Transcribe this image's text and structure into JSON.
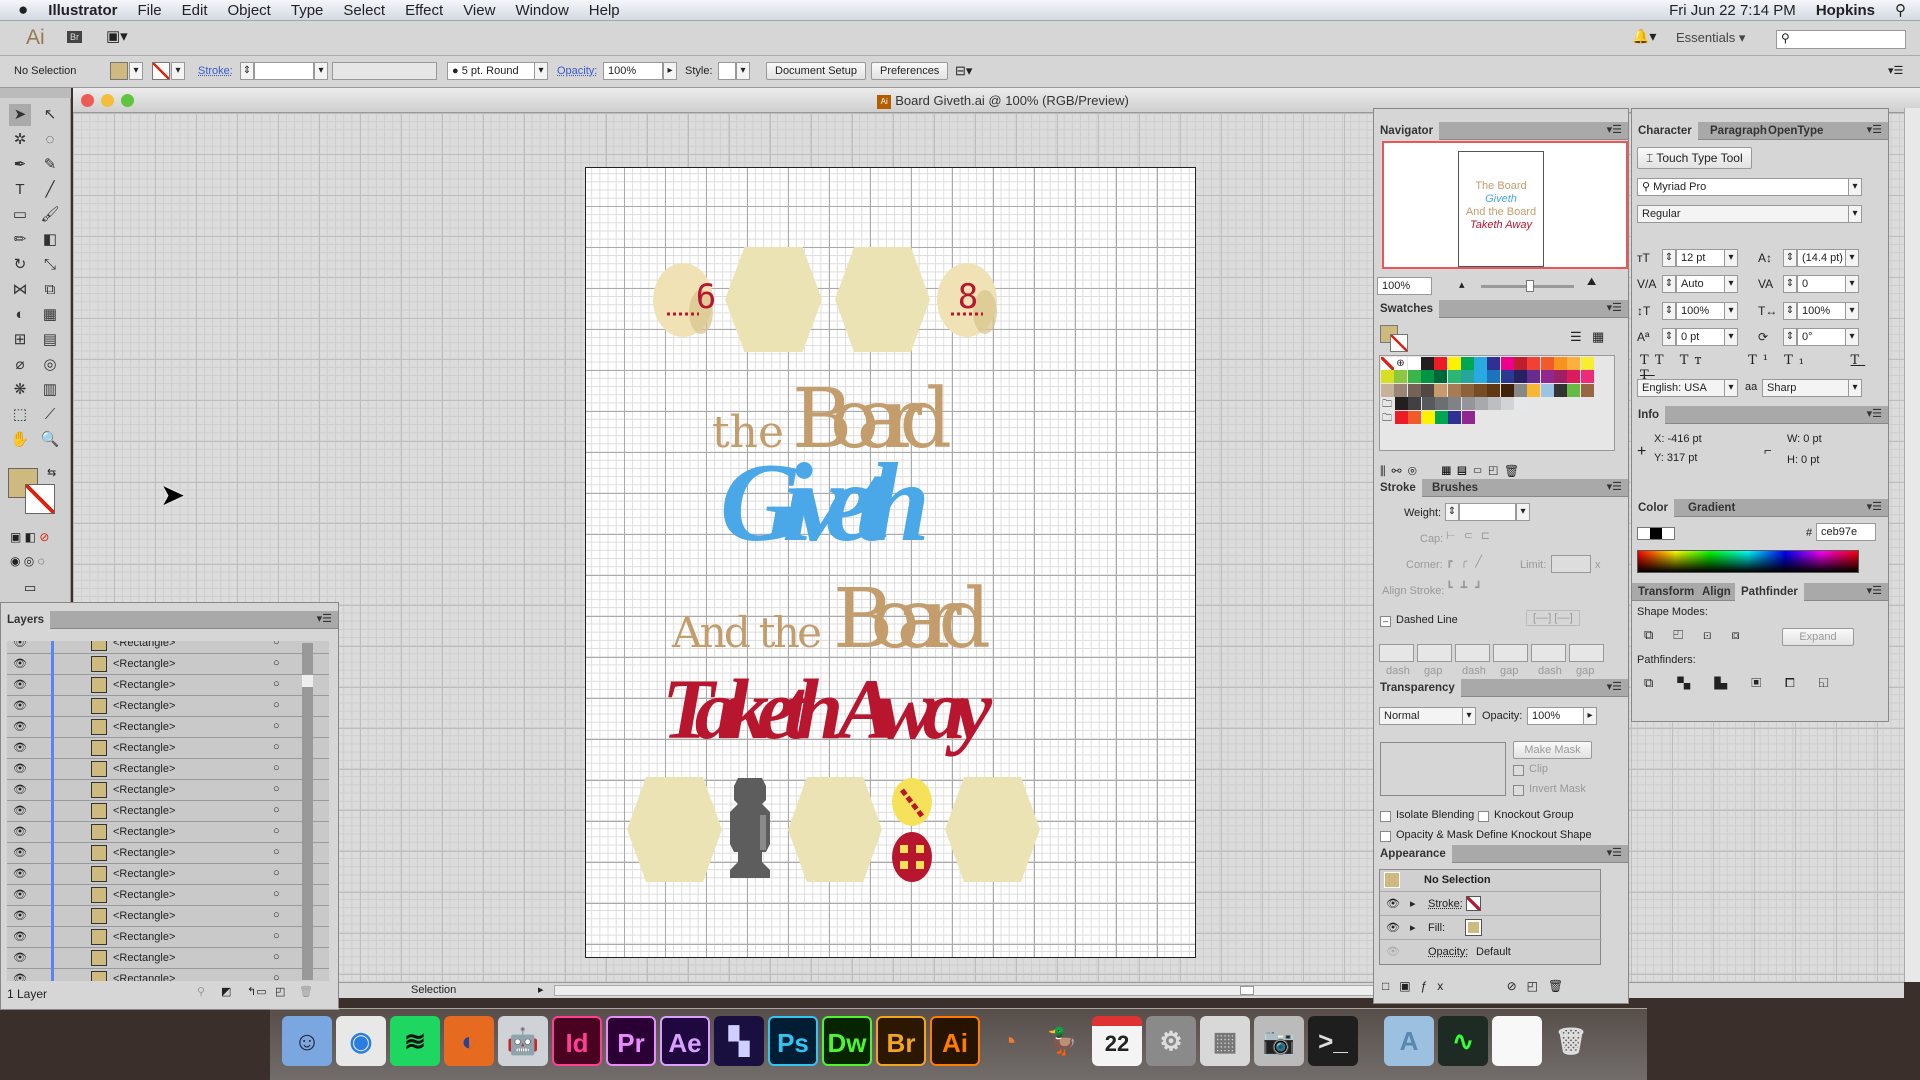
{
  "menubar": {
    "apple": "",
    "items": [
      "Illustrator",
      "File",
      "Edit",
      "Object",
      "Type",
      "Select",
      "Effect",
      "View",
      "Window",
      "Help"
    ],
    "clock": "Fri Jun 22  7:14 PM",
    "user": "Hopkins"
  },
  "appbar": {
    "logo": "Ai",
    "bridge": "Br",
    "workspace": "Essentials",
    "search_placeholder": ""
  },
  "control": {
    "selection": "No Selection",
    "stroke_label": "Stroke:",
    "brush": "5 pt. Round",
    "opacity_label": "Opacity:",
    "opacity": "100%",
    "style_label": "Style:",
    "document_setup": "Document Setup",
    "preferences": "Preferences",
    "fill_color": "#ceb97e"
  },
  "document": {
    "title": "Board Giveth.ai @ 100% (RGB/Preview)",
    "zoom_status": "Selection"
  },
  "artwork": {
    "line1_small": "the",
    "line1_big": "Board",
    "line2": "Giveth",
    "line3_small": "And the",
    "line3_big": "Board",
    "line4": "Taketh Away",
    "die1": "6",
    "die2": "8",
    "colors": {
      "hex": "#ece3b4",
      "tan": "#c49d6d",
      "blue": "#4aa8e8",
      "red": "#b8162e",
      "die": "#f0e2b5",
      "pawn": "#5d5d5d",
      "yellow": "#f5e25a"
    }
  },
  "tools": [
    {
      "name": "selection-tool",
      "glyph": "➤"
    },
    {
      "name": "direct-selection-tool",
      "glyph": "↖"
    },
    {
      "name": "magic-wand-tool",
      "glyph": "✲"
    },
    {
      "name": "lasso-tool",
      "glyph": "◌"
    },
    {
      "name": "pen-tool",
      "glyph": "✒"
    },
    {
      "name": "curvature-tool",
      "glyph": "✎"
    },
    {
      "name": "type-tool",
      "glyph": "T"
    },
    {
      "name": "line-tool",
      "glyph": "╱"
    },
    {
      "name": "rectangle-tool",
      "glyph": "▭"
    },
    {
      "name": "paintbrush-tool",
      "glyph": "🖌"
    },
    {
      "name": "pencil-tool",
      "glyph": "✏"
    },
    {
      "name": "eraser-tool",
      "glyph": "◧"
    },
    {
      "name": "rotate-tool",
      "glyph": "↻"
    },
    {
      "name": "scale-tool",
      "glyph": "⤡"
    },
    {
      "name": "width-tool",
      "glyph": "⋈"
    },
    {
      "name": "free-transform-tool",
      "glyph": "⧉"
    },
    {
      "name": "shape-builder-tool",
      "glyph": "◐"
    },
    {
      "name": "perspective-grid-tool",
      "glyph": "▦"
    },
    {
      "name": "mesh-tool",
      "glyph": "⊞"
    },
    {
      "name": "gradient-tool",
      "glyph": "▤"
    },
    {
      "name": "eyedropper-tool",
      "glyph": "⌀"
    },
    {
      "name": "blend-tool",
      "glyph": "◎"
    },
    {
      "name": "symbol-sprayer-tool",
      "glyph": "❋"
    },
    {
      "name": "column-graph-tool",
      "glyph": "▥"
    },
    {
      "name": "artboard-tool",
      "glyph": "⬚"
    },
    {
      "name": "slice-tool",
      "glyph": "⟋"
    },
    {
      "name": "hand-tool",
      "glyph": "✋"
    },
    {
      "name": "zoom-tool",
      "glyph": "🔍"
    }
  ],
  "layers": {
    "title": "Layers",
    "footer": "1 Layer",
    "rows": [
      "<Rectangle>",
      "<Rectangle>",
      "<Rectangle>",
      "<Rectangle>",
      "<Rectangle>",
      "<Rectangle>",
      "<Rectangle>",
      "<Rectangle>",
      "<Rectangle>",
      "<Rectangle>",
      "<Rectangle>",
      "<Rectangle>",
      "<Rectangle>",
      "<Rectangle>",
      "<Rectangle>",
      "<Rectangle>",
      "<Rectangle>"
    ]
  },
  "navigator": {
    "title": "Navigator",
    "zoom": "100%"
  },
  "swatches": {
    "title": "Swatches",
    "colors": [
      "#ffffff",
      "#231f20",
      "#ed1c24",
      "#fff200",
      "#00a651",
      "#29abe2",
      "#2e3192",
      "#ec008c",
      "#be1e2d",
      "#ef4136",
      "#f15a29",
      "#f7941d",
      "#fbb040",
      "#f9ed32",
      "#d7df23",
      "#8dc63f",
      "#39b54a",
      "#009444",
      "#006838",
      "#2bb673",
      "#26a69a",
      "#27aae1",
      "#1c75bc",
      "#2b3990",
      "#262262",
      "#662d91",
      "#92278f",
      "#9e1f63",
      "#da1c5c",
      "#ee2a7b",
      "#c7b299",
      "#998675",
      "#736357",
      "#534741",
      "#c69c6d",
      "#a67c52",
      "#8c6239",
      "#754c24",
      "#603913",
      "#42210b",
      "#888888",
      "#f7b733",
      "#9cc3e6",
      "#333333",
      "#66bb44",
      "#996644"
    ],
    "grays": [
      "#231f20",
      "#414042",
      "#58595b",
      "#6d6e71",
      "#808285",
      "#939598",
      "#a7a9ac",
      "#bcbec0",
      "#d1d3d4",
      "#e6e7e8"
    ],
    "brights": [
      "#ed1c24",
      "#f15a29",
      "#fff200",
      "#00a651",
      "#2e3192",
      "#92278f"
    ]
  },
  "stroke": {
    "tab": "Stroke",
    "tab2": "Brushes",
    "weight": "Weight:",
    "cap": "Cap:",
    "corner": "Corner:",
    "limit": "Limit:",
    "limit_x": "x",
    "align": "Align Stroke:",
    "dashed": "Dashed Line",
    "dash_labels": [
      "dash",
      "gap",
      "dash",
      "gap",
      "dash",
      "gap"
    ]
  },
  "transparency": {
    "title": "Transparency",
    "mode": "Normal",
    "opacity_label": "Opacity:",
    "opacity": "100%",
    "make_mask": "Make Mask",
    "clip": "Clip",
    "invert": "Invert Mask",
    "isolate": "Isolate Blending",
    "knockout": "Knockout Group",
    "define": "Opacity & Mask Define Knockout Shape"
  },
  "appearance": {
    "title": "Appearance",
    "header": "No Selection",
    "stroke": "Stroke:",
    "fill": "Fill:",
    "opacity": "Opacity:",
    "opacity_value": "Default"
  },
  "character": {
    "tabs": [
      "Character",
      "Paragraph",
      "OpenType"
    ],
    "touch_type": "Touch Type Tool",
    "font": "Myriad Pro",
    "style": "Regular",
    "size": "12 pt",
    "leading": "(14.4 pt)",
    "kerning": "Auto",
    "tracking": "0",
    "vscale": "100%",
    "hscale": "100%",
    "baseline": "0 pt",
    "rotation": "0°",
    "language": "English: USA",
    "aa_label": "aa",
    "antialias": "Sharp"
  },
  "info": {
    "title": "Info",
    "x": "X:  -416 pt",
    "y": "Y:  317 pt",
    "w": "W:  0 pt",
    "h": "H:  0 pt"
  },
  "color": {
    "tabs": [
      "Color",
      "Gradient"
    ],
    "hash": "#",
    "hex": "ceb97e"
  },
  "pathfinder": {
    "tabs": [
      "Transform",
      "Align",
      "Pathfinder"
    ],
    "shape_modes": "Shape Modes:",
    "expand": "Expand",
    "pathfinders": "Pathfinders:"
  },
  "dock": [
    {
      "name": "finder",
      "label": "☺",
      "bg": "#7aa7e0",
      "fg": "#223"
    },
    {
      "name": "chrome",
      "label": "◉",
      "bg": "#e8e8e8",
      "fg": "#2a7de1"
    },
    {
      "name": "spotify",
      "label": "≋",
      "bg": "#1ed760",
      "fg": "#111"
    },
    {
      "name": "firefox",
      "label": "◐",
      "bg": "#e66a1f",
      "fg": "#23449a"
    },
    {
      "name": "automator",
      "label": "🤖",
      "bg": "#cfd3d8",
      "fg": "#333"
    },
    {
      "name": "indesign",
      "label": "Id",
      "bg": "#49021f",
      "fg": "#ff3f94"
    },
    {
      "name": "premiere",
      "label": "Pr",
      "bg": "#2a0034",
      "fg": "#e98bff"
    },
    {
      "name": "after-effects",
      "label": "Ae",
      "bg": "#1f0740",
      "fg": "#d8a1ff"
    },
    {
      "name": "media-encoder",
      "label": "▚",
      "bg": "#1a1040",
      "fg": "#cfd0ff"
    },
    {
      "name": "photoshop",
      "label": "Ps",
      "bg": "#001d34",
      "fg": "#31c5f0"
    },
    {
      "name": "dreamweaver",
      "label": "Dw",
      "bg": "#072401",
      "fg": "#4cf52d"
    },
    {
      "name": "bridge",
      "label": "Br",
      "bg": "#2c1800",
      "fg": "#f2a51e"
    },
    {
      "name": "illustrator",
      "label": "Ai",
      "bg": "#261300",
      "fg": "#ff7c00"
    },
    {
      "name": "blender",
      "label": "◔",
      "bg": "transparent",
      "fg": "#f5792a"
    },
    {
      "name": "cyberduck",
      "label": "🦆",
      "bg": "transparent",
      "fg": "#f5d000"
    },
    {
      "name": "calendar",
      "label": "22",
      "bg": "#f4f4f4",
      "fg": "#222"
    },
    {
      "name": "system-preferences",
      "label": "⚙",
      "bg": "#8a8a8a",
      "fg": "#ddd"
    },
    {
      "name": "calculator",
      "label": "▦",
      "bg": "#d8d8d8",
      "fg": "#777"
    },
    {
      "name": "image-capture",
      "label": "📷",
      "bg": "#bbb",
      "fg": "#222"
    },
    {
      "name": "terminal",
      "label": ">_",
      "bg": "#1e1e1e",
      "fg": "#ddd"
    },
    {
      "name": "applications-folder",
      "label": "A",
      "bg": "#9cc0e0",
      "fg": "#5a86b0"
    },
    {
      "name": "activity-monitor",
      "label": "∿",
      "bg": "#1e2a24",
      "fg": "#3f3"
    },
    {
      "name": "document",
      "label": "",
      "bg": "#f8f8f8",
      "fg": "#ccc"
    },
    {
      "name": "trash",
      "label": "🗑",
      "bg": "transparent",
      "fg": "#ddd"
    }
  ]
}
